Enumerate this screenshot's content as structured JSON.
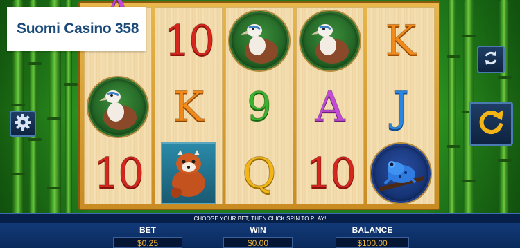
{
  "brand": {
    "name": "Suomi Casino 358"
  },
  "reels": [
    {
      "cells": [
        {
          "symbol": "A",
          "partial": true
        },
        {
          "symbol": "vulture"
        },
        {
          "symbol": "10"
        }
      ]
    },
    {
      "cells": [
        {
          "symbol": "10"
        },
        {
          "symbol": "K"
        },
        {
          "symbol": "red-panda"
        }
      ]
    },
    {
      "cells": [
        {
          "symbol": "vulture"
        },
        {
          "symbol": "9"
        },
        {
          "symbol": "Q"
        }
      ]
    },
    {
      "cells": [
        {
          "symbol": "vulture"
        },
        {
          "symbol": "A"
        },
        {
          "symbol": "10"
        }
      ]
    },
    {
      "cells": [
        {
          "symbol": "K"
        },
        {
          "symbol": "J"
        },
        {
          "symbol": "blue-frog"
        }
      ]
    }
  ],
  "controls": {
    "autoplay_icon": "autoplay-cycle-icon",
    "spin_icon": "spin-arrow-icon",
    "settings_icon": "gear-icon"
  },
  "message": "CHOOSE YOUR BET, THEN CLICK SPIN TO PLAY!",
  "stats": {
    "bet_label": "BET",
    "bet_value": "$0.25",
    "win_label": "WIN",
    "win_value": "$0.00",
    "balance_label": "BALANCE",
    "balance_value": "$100.00"
  },
  "colors": {
    "ten": "#d7261c",
    "king": "#f28a1a",
    "ace": "#c44bd8",
    "nine": "#3bb22d",
    "jack": "#2a86e0",
    "queen": "#f2b515",
    "panel": "#0a2a5c",
    "value_text": "#f0b63a"
  }
}
